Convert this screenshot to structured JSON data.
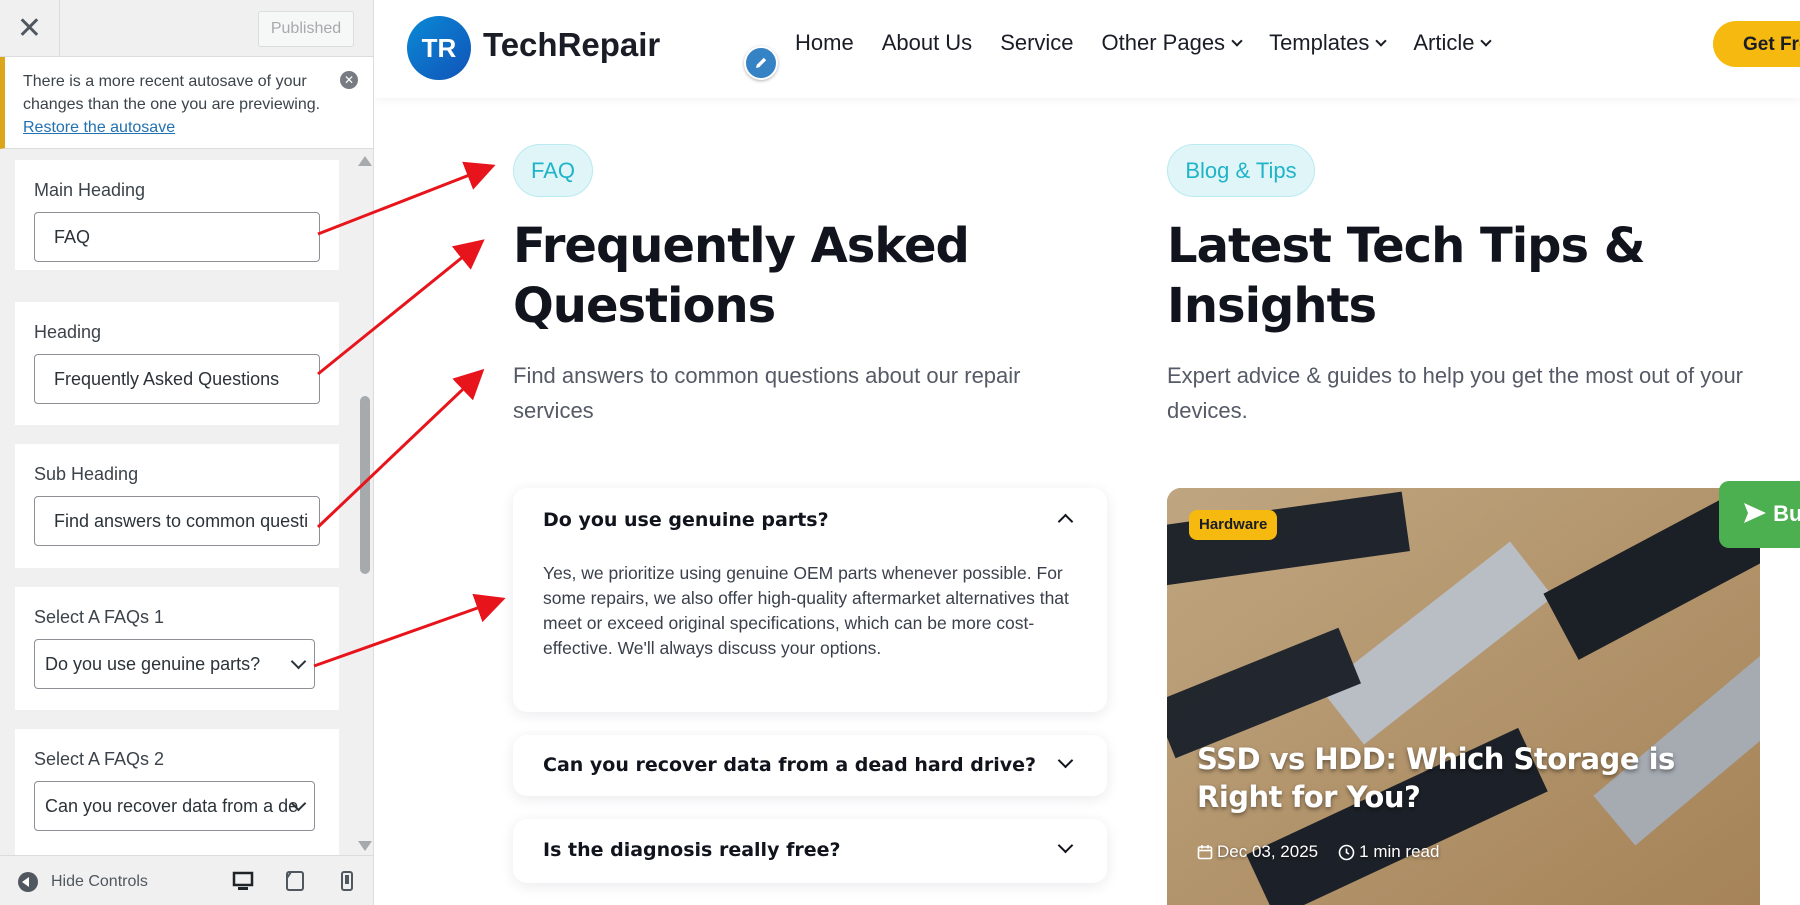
{
  "sidebar": {
    "close_glyph": "✕",
    "publish_label": "Published",
    "notice": {
      "text": "There is a more recent autosave of your changes than the one you are previewing.",
      "link": "Restore the autosave",
      "dismiss_glyph": "✕"
    },
    "controls": [
      {
        "label": "Main Heading",
        "value": "FAQ"
      },
      {
        "label": "Heading",
        "value": "Frequently Asked Questions"
      },
      {
        "label": "Sub Heading",
        "value": "Find answers to common questi"
      },
      {
        "label": "Select A FAQs 1",
        "value": "Do you use genuine parts?"
      },
      {
        "label": "Select A FAQs 2",
        "value": "Can you recover data from a de"
      }
    ],
    "footer": {
      "hide_label": "Hide Controls"
    }
  },
  "site": {
    "logo_initials": "TR",
    "logo_text": "TechRepair",
    "nav": [
      {
        "label": "Home",
        "dropdown": false
      },
      {
        "label": "About Us",
        "dropdown": false
      },
      {
        "label": "Service",
        "dropdown": false
      },
      {
        "label": "Other Pages",
        "dropdown": true
      },
      {
        "label": "Templates",
        "dropdown": true
      },
      {
        "label": "Article",
        "dropdown": true
      }
    ],
    "cta_label": "Get Fre"
  },
  "faq_section": {
    "badge": "FAQ",
    "heading": "Frequently Asked Questions",
    "subheading": "Find answers to common questions about our repair services",
    "items": [
      {
        "question": "Do you use genuine parts?",
        "answer": "Yes, we prioritize using genuine OEM parts whenever possible. For some repairs, we also offer high-quality aftermarket alternatives that meet or exceed original specifications, which can be more cost-effective. We'll always discuss your options.",
        "expanded": true
      },
      {
        "question": "Can you recover data from a dead hard drive?",
        "expanded": false
      },
      {
        "question": "Is the diagnosis really free?",
        "expanded": false
      }
    ]
  },
  "blog_section": {
    "badge": "Blog & Tips",
    "heading": "Latest Tech Tips & Insights",
    "subheading": "Expert advice & guides to help you get the most out of your devices.",
    "post": {
      "tag": "Hardware",
      "title": "SSD vs HDD: Which Storage is Right for You?",
      "date": "Dec 03, 2025",
      "read_time": "1 min read"
    }
  },
  "floating_button": {
    "label": "Bu"
  },
  "colors": {
    "accent_teal": "#1fb4c8",
    "brand_yellow": "#f6b90f",
    "annotation_red": "#e8141b",
    "float_green": "#4caf50"
  }
}
